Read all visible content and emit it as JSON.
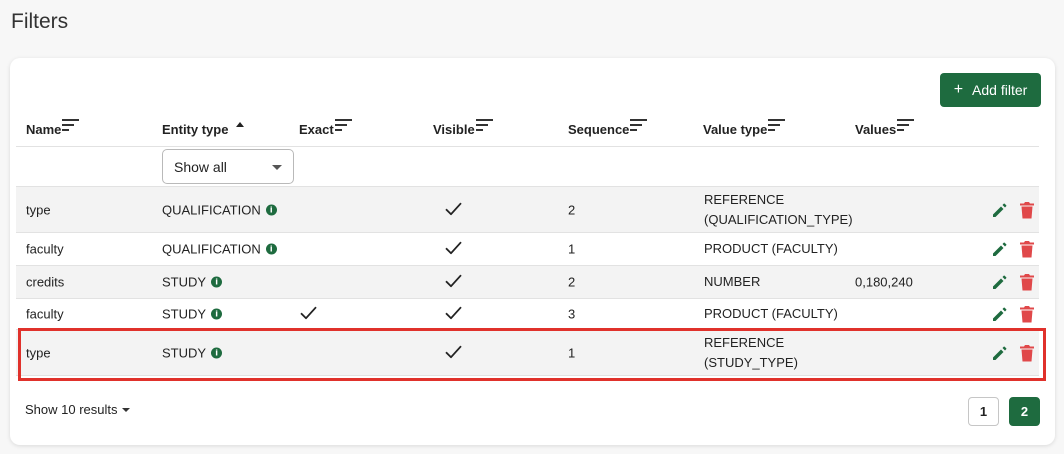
{
  "page": {
    "title": "Filters"
  },
  "toolbar": {
    "add_label": "Add filter",
    "add_icon": "plus-icon"
  },
  "table": {
    "columns": [
      "Name",
      "Entity type",
      "Exact",
      "Visible",
      "Sequence",
      "Value type",
      "Values"
    ],
    "entity_filter": {
      "selected": "Show all"
    },
    "rows": [
      {
        "name": "type",
        "entity_type": "QUALIFICATION",
        "exact": false,
        "visible": true,
        "sequence": "2",
        "value_type": "REFERENCE\n(QUALIFICATION_TYPE)",
        "values": ""
      },
      {
        "name": "faculty",
        "entity_type": "QUALIFICATION",
        "exact": false,
        "visible": true,
        "sequence": "1",
        "value_type": "PRODUCT (FACULTY)",
        "values": ""
      },
      {
        "name": "credits",
        "entity_type": "STUDY",
        "exact": false,
        "visible": true,
        "sequence": "2",
        "value_type": "NUMBER",
        "values": "0,180,240"
      },
      {
        "name": "faculty",
        "entity_type": "STUDY",
        "exact": true,
        "visible": true,
        "sequence": "3",
        "value_type": "PRODUCT (FACULTY)",
        "values": ""
      },
      {
        "name": "type",
        "entity_type": "STUDY",
        "exact": false,
        "visible": true,
        "sequence": "1",
        "value_type": "REFERENCE\n(STUDY_TYPE)",
        "values": ""
      }
    ]
  },
  "footer": {
    "show_results": "Show 10 results",
    "pages": [
      "1",
      "2"
    ],
    "current_page": "2"
  },
  "colors": {
    "accent": "#1e6b3f",
    "delete": "#e0484a",
    "highlight": "#e0312b"
  }
}
